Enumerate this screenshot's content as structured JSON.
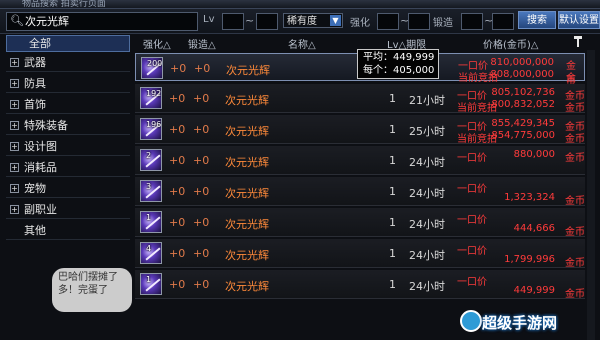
{
  "window": {
    "title": "物品搜索 拍卖行页面"
  },
  "search": {
    "icon": "search-icon",
    "query": "次元光辉",
    "lv_label": "Lv",
    "tilde": "~",
    "rarity": "稀有度",
    "enhance_label": "强化",
    "forge_label": "锻造",
    "search_button": "搜索",
    "reset_button": "默认设置"
  },
  "categories": [
    {
      "label": "全部",
      "selected": true
    },
    {
      "label": "武器",
      "expand": "+"
    },
    {
      "label": "防具",
      "expand": "+"
    },
    {
      "label": "首饰",
      "expand": "+"
    },
    {
      "label": "特殊装备",
      "expand": "+"
    },
    {
      "label": "设计图",
      "expand": "+"
    },
    {
      "label": "消耗品",
      "expand": "+"
    },
    {
      "label": "宠物",
      "expand": "+"
    },
    {
      "label": "副职业",
      "expand": "+"
    },
    {
      "label": "其他"
    }
  ],
  "headers": {
    "enhance": "强化△",
    "forge": "锻造△",
    "name": "名称△",
    "lv_duration": "Lv△期限",
    "price": "价格(金币)△"
  },
  "tooltip": {
    "avg": "平均：449,999",
    "each": "每个：405,000"
  },
  "rows": [
    {
      "qty": "2000",
      "enhance": "+0",
      "forge": "+0",
      "name": "次元光辉",
      "lv": "",
      "duration": "",
      "buyout_label": "一口价",
      "buyout": "810,000,000",
      "bid_label": "当前竞拍",
      "bid": "808,000,000",
      "unit": "金币",
      "unit2": "金币"
    },
    {
      "qty": "1922",
      "enhance": "+0",
      "forge": "+0",
      "name": "次元光辉",
      "lv": "1",
      "duration": "21小时",
      "buyout_label": "一口价",
      "buyout": "805,102,736",
      "bid_label": "当前竞拍",
      "bid": "800,832,052",
      "unit": "金币",
      "unit2": "金币"
    },
    {
      "qty": "1965",
      "enhance": "+0",
      "forge": "+0",
      "name": "次元光辉",
      "lv": "1",
      "duration": "25小时",
      "buyout_label": "一口价",
      "buyout": "855,429,345",
      "bid_label": "当前竞拍",
      "bid": "854,775,000",
      "unit": "金币",
      "unit2": "金币"
    },
    {
      "qty": "2",
      "enhance": "+0",
      "forge": "+0",
      "name": "次元光辉",
      "lv": "1",
      "duration": "24小时",
      "buyout_label": "一口价",
      "buyout": "880,000",
      "unit": "金币"
    },
    {
      "qty": "3",
      "enhance": "+0",
      "forge": "+0",
      "name": "次元光辉",
      "lv": "1",
      "duration": "24小时",
      "buyout_label": "一口价",
      "buyout": "1,323,324",
      "unit": "金币"
    },
    {
      "qty": "1",
      "enhance": "+0",
      "forge": "+0",
      "name": "次元光辉",
      "lv": "1",
      "duration": "24小时",
      "buyout_label": "一口价",
      "buyout": "444,666",
      "unit": "金币"
    },
    {
      "qty": "4",
      "enhance": "+0",
      "forge": "+0",
      "name": "次元光辉",
      "lv": "1",
      "duration": "24小时",
      "buyout_label": "一口价",
      "buyout": "1,799,996",
      "unit": "金币"
    },
    {
      "qty": "1",
      "enhance": "+0",
      "forge": "+0",
      "name": "次元光辉",
      "lv": "1",
      "duration": "24小时",
      "buyout_label": "一口价",
      "buyout": "449,999",
      "unit": "金币"
    }
  ],
  "mascot_text": "巴哈们摆摊了多！完蛋了",
  "watermark": "超级手游网",
  "colors": {
    "accent": "#3d6fb8",
    "price": "#ff3b3b",
    "name": "#ff8a3a"
  }
}
